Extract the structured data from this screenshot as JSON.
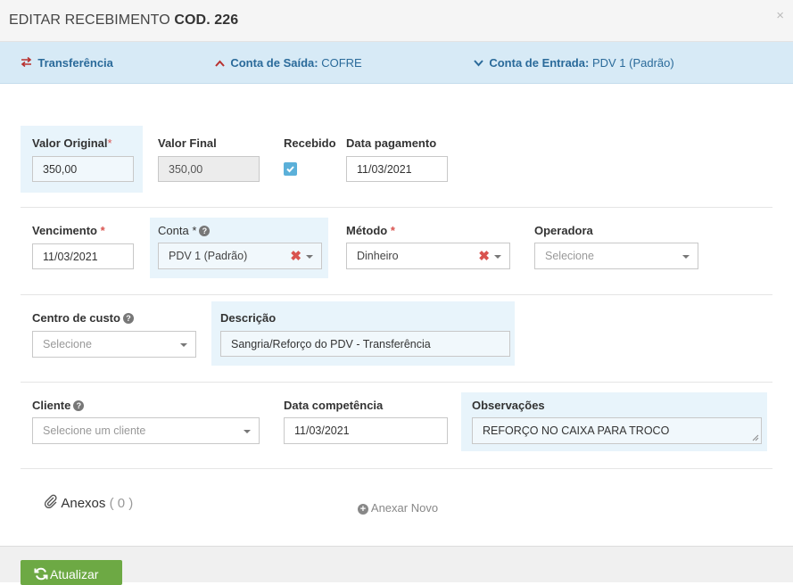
{
  "modal": {
    "title_prefix": "EDITAR RECEBIMENTO",
    "title_code": "COD. 226",
    "close": "×"
  },
  "infobar": {
    "transfer": "Transferência",
    "saida_label": "Conta de Saída:",
    "saida_value": "COFRE",
    "entrada_label": "Conta de Entrada:",
    "entrada_value": "PDV 1 (Padrão)"
  },
  "form": {
    "valor_original": {
      "label": "Valor Original",
      "required": "*",
      "value": "350,00"
    },
    "valor_final": {
      "label": "Valor Final",
      "value": "350,00"
    },
    "recebido": {
      "label": "Recebido",
      "checked": true
    },
    "data_pagamento": {
      "label": "Data pagamento",
      "value": "11/03/2021"
    },
    "vencimento": {
      "label": "Vencimento",
      "required": "*",
      "value": "11/03/2021"
    },
    "conta": {
      "label": "Conta",
      "required": "*",
      "value": "PDV 1 (Padrão)"
    },
    "metodo": {
      "label": "Método",
      "required": "*",
      "value": "Dinheiro"
    },
    "operadora": {
      "label": "Operadora",
      "placeholder": "Selecione"
    },
    "centro_custo": {
      "label": "Centro de custo",
      "placeholder": "Selecione"
    },
    "descricao": {
      "label": "Descrição",
      "value": "Sangria/Reforço do PDV - Transferência"
    },
    "cliente": {
      "label": "Cliente",
      "placeholder": "Selecione um cliente"
    },
    "data_competencia": {
      "label": "Data competência",
      "value": "11/03/2021"
    },
    "observacoes": {
      "label": "Observações",
      "value": "REFORÇO NO CAIXA PARA TROCO"
    }
  },
  "anexos": {
    "label": "Anexos",
    "count": "( 0 )",
    "add": "Anexar Novo"
  },
  "footer": {
    "update": "Atualizar"
  },
  "colors": {
    "accent_blue": "#5bb0d9",
    "required_red": "#d9534f",
    "update_green": "#6da944",
    "infobar_bg": "#d7eaf6"
  }
}
